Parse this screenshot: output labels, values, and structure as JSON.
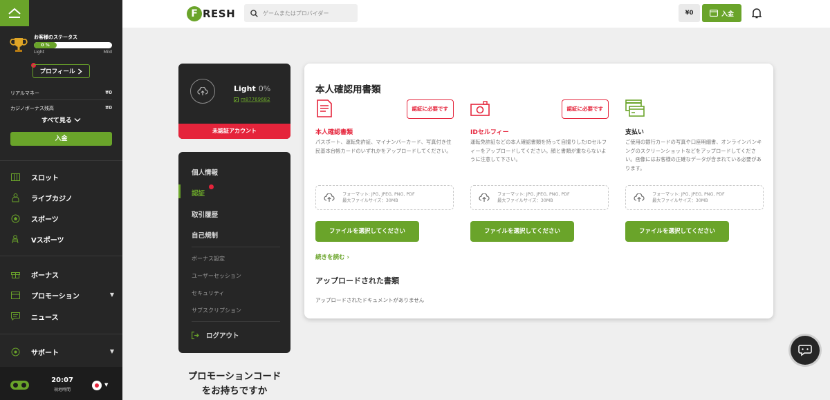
{
  "sidebar": {
    "status": {
      "title": "お客様のステータス",
      "progress_label": "0 %",
      "progress_value": 0,
      "level_from": "Light",
      "level_to": "Mild"
    },
    "profile_label": "プロフィール",
    "balances": [
      {
        "label": "リアルマネー",
        "value": "¥0"
      },
      {
        "label": "カジノボーナス残高",
        "value": "¥0"
      }
    ],
    "see_all": "すべて見る",
    "deposit": "入金",
    "nav": [
      {
        "label": "スロット",
        "icon": "slot-icon"
      },
      {
        "label": "ライブカジノ",
        "icon": "live-casino-icon"
      },
      {
        "label": "スポーツ",
        "icon": "soccer-ball-icon"
      },
      {
        "label": "Vスポーツ",
        "icon": "vsport-icon"
      },
      {
        "label": "ボーナス",
        "icon": "gift-icon"
      },
      {
        "label": "プロモーション",
        "icon": "promotion-icon"
      },
      {
        "label": "ニュース",
        "icon": "news-icon"
      },
      {
        "label": "サポート",
        "icon": "support-icon"
      }
    ],
    "clock": {
      "time": "20:07",
      "label": "現地時間"
    }
  },
  "header": {
    "logo_letter": "F",
    "logo_text": "RESH",
    "search_placeholder": "ゲームまたはプロバイダー",
    "balance": "¥0",
    "deposit": "入金"
  },
  "account": {
    "level": "Light",
    "percent": "0%",
    "user_id": "m87769682",
    "status": "未認証アカウント"
  },
  "menu": {
    "items": [
      "個人情報",
      "認証",
      "取引履歴",
      "自己規制"
    ],
    "sub_items": [
      "ボーナス設定",
      "ユーザーセッション",
      "セキュリティ",
      "サブスクリプション"
    ],
    "logout": "ログアウト"
  },
  "promo": {
    "line1": "プロモーションコード",
    "line2": "をお持ちですか"
  },
  "documents": {
    "title": "本人確認用書類",
    "columns": [
      {
        "title": "本人確認書類",
        "badge": "認証に必要です",
        "desc": "パスポート、運転免許証、マイナンバーカード、写真付き住民基本台帳カードのいずれかをアップロードしてください。",
        "formats": "フォーマット: JPG, JPEG, PNG, PDF",
        "max_size": "最大ファイルサイズ：30MB",
        "button": "ファイルを選択してください",
        "icon": "document-icon"
      },
      {
        "title": "IDセルフィー",
        "badge": "認証に必要です",
        "desc": "運転免許証などの本人確認書類を持って自撮りしたIDセルフィーをアップロードしてください。顔と書類が重ならないように注意して下さい。",
        "formats": "フォーマット: JPG, JPEG, PNG, PDF",
        "max_size": "最大ファイルサイズ：30MB",
        "button": "ファイルを選択してください",
        "icon": "camera-icon"
      },
      {
        "title": "支払い",
        "badge": "",
        "desc": "ご使用の銀行カードの写真や口座明細書、オンラインバンキングのスクリーンショットなどをアップロードしてください。画像にはお客様の正確なデータが含まれている必要があります。",
        "formats": "フォーマット: JPG, JPEG, PNG, PDF",
        "max_size": "最大ファイルサイズ：30MB",
        "button": "ファイルを選択してください",
        "icon": "payment-card-icon"
      }
    ],
    "read_more": "続きを読む",
    "uploaded_title": "アップロードされた書類",
    "uploaded_empty": "アップロードされたドキュメントがありません"
  },
  "colors": {
    "accent": "#6aa42a",
    "danger": "#e5243b",
    "sidebar": "#262626"
  }
}
